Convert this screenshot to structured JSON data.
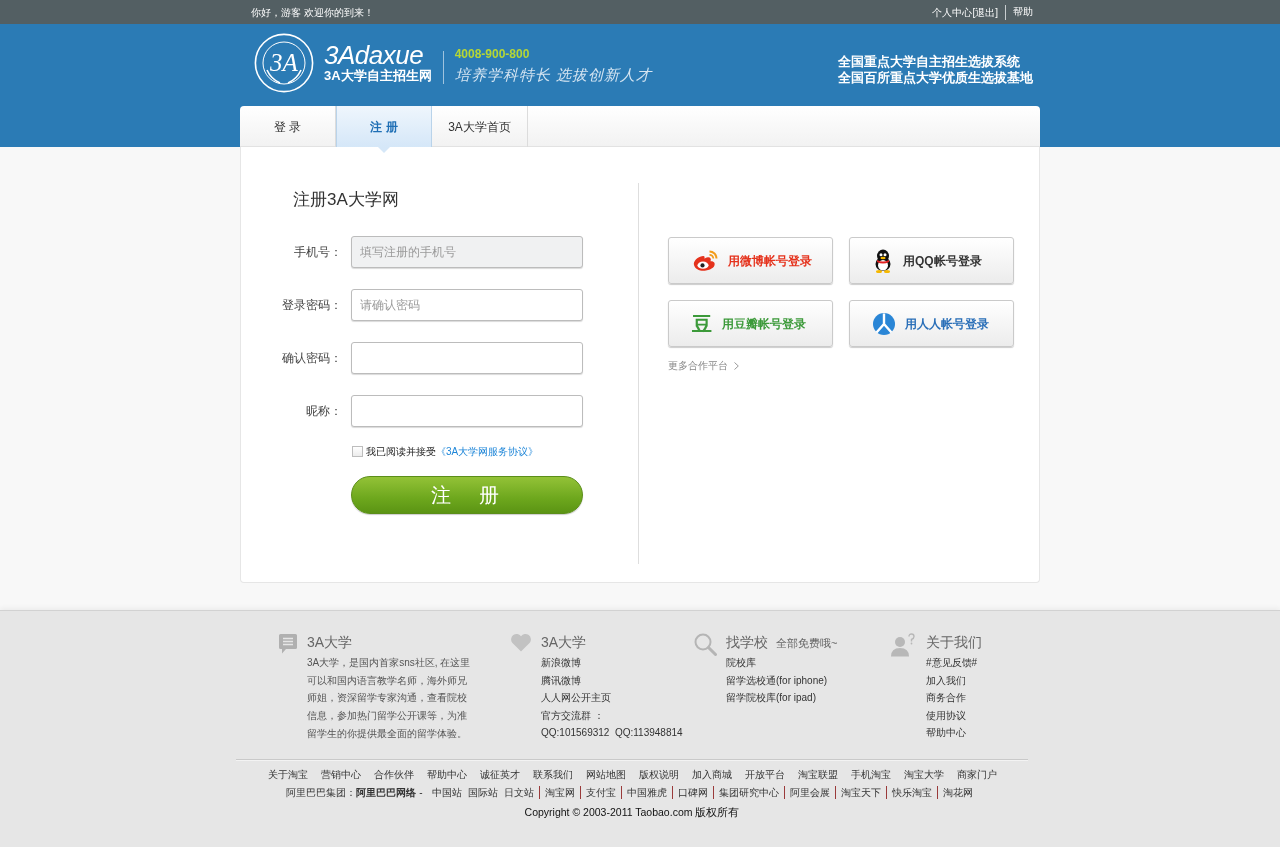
{
  "top_bar": {
    "greeting": "你好，游客 欢迎你的到来！",
    "link_groups": [
      [
        "个人中心",
        "[退出]"
      ],
      [
        "帮助"
      ]
    ]
  },
  "header": {
    "logo": {
      "emblem_text": "3A",
      "wordmark": "3Adaxue",
      "site_name": "3A大学自主招生网"
    },
    "phone": "4008-900-800",
    "slogan": "培养学科特长 选拔创新人才",
    "taglines": [
      "全国重点大学自主招生选拔系统",
      "全国百所重点大学优质生选拔基地"
    ]
  },
  "tabs": [
    {
      "label": "登 录",
      "selected": false
    },
    {
      "label": "注 册",
      "selected": true
    },
    {
      "label": "3A大学首页",
      "selected": false
    }
  ],
  "register_form": {
    "title": "注册3A大学网",
    "fields": [
      {
        "label": "手机号：",
        "placeholder": "填写注册的手机号",
        "focused": true
      },
      {
        "label": "登录密码：",
        "placeholder": "请确认密码",
        "focused": false
      },
      {
        "label": "确认密码：",
        "focused": false
      },
      {
        "label": "昵称：",
        "focused": false
      }
    ],
    "agreement": {
      "checked": false,
      "text": "我已阅读并接受",
      "link": "《3A大学网服务协议》"
    },
    "submit": "注　册"
  },
  "social_login": {
    "buttons": [
      {
        "label": "用微博帐号登录",
        "color": "#e5321c"
      },
      {
        "label": "用QQ帐号登录",
        "color": "#333333"
      },
      {
        "label": "用豆瓣帐号登录",
        "color": "#3c9a3a",
        "glyph": "豆"
      },
      {
        "label": "用人人帐号登录",
        "color": "#2a6fb8"
      }
    ],
    "more": "更多合作平台"
  },
  "footer": {
    "columns": [
      {
        "title": "3A大学",
        "text": "3A大学，是国内首家sns社区, 在这里可以和国内语言教学名师，海外师兄师姐，资深留学专家沟通，查看院校信息，参加热门留学公开课等，为准留学生的你提供最全面的留学体验。"
      },
      {
        "title": "3A大学",
        "links": [
          "新浪微博",
          "腾讯微博",
          "人人网公开主页",
          "官方交流群 ：",
          "QQ:101569312  QQ:113948814"
        ]
      },
      {
        "title": "找学校",
        "subtitle": "全部免费哦~",
        "links": [
          "院校库",
          "留学选校通(for iphone)",
          "留学院校库(for ipad)"
        ]
      },
      {
        "title": "关于我们",
        "links": [
          "#意见反馈#",
          "加入我们",
          "商务合作",
          "使用协议",
          "帮助中心"
        ]
      }
    ],
    "links": [
      "关于淘宝",
      "营销中心",
      "合作伙伴",
      "帮助中心",
      "诚征英才",
      "联系我们",
      "网站地图",
      "版权说明",
      "加入商城",
      "开放平台",
      "淘宝联盟",
      "手机淘宝",
      "淘宝大学",
      "商家门户"
    ],
    "group_label": "阿里巴巴集团：**阿里巴巴网络** -",
    "site_groups": [
      [
        "中国站",
        "国际站",
        "日文站"
      ],
      [
        "淘宝网"
      ],
      [
        "支付宝"
      ],
      [
        "中国雅虎"
      ],
      [
        "口碑网"
      ],
      [
        "集团研究中心"
      ],
      [
        "阿里会展"
      ],
      [
        "淘宝天下"
      ],
      [
        "快乐淘宝"
      ],
      [
        "淘花网"
      ]
    ],
    "copyright": "Copyright © 2003-2011 Taobao.com 版权所有"
  }
}
